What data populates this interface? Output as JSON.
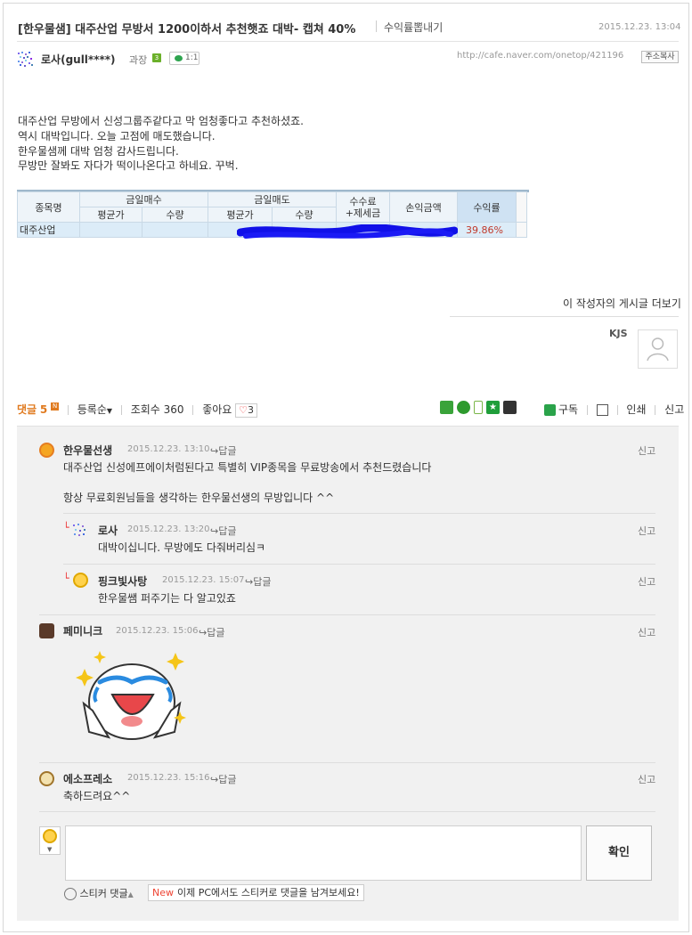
{
  "post": {
    "title": "[한우물샘] 대주산업 무방서 1200이하서 추천햇죠 대박- 캡쳐 40%",
    "export_label": "수익률뽑내기",
    "date": "2015.12.23. 13:04",
    "author": "로사(gull****)",
    "grade": "과장",
    "grade_level": "3",
    "chat_label": "1:1",
    "url": "http://cafe.naver.com/onetop/421196",
    "copy_label": "주소복사",
    "body_lines": [
      "대주산업 무방에서 신성그룹주같다고 막 엄청좋다고 추천하셨죠.",
      "역시 대박입니다. 오늘 고점에 매도했습니다.",
      "한우물샘께 대박 엄청 감사드립니다.",
      "무방만 잘봐도 자다가 떡이나온다고 하네요. 꾸벅."
    ],
    "more_posts_label": "이 작성자의 게시글 더보기",
    "signature_name": "KJS"
  },
  "trade_table": {
    "headers": {
      "stock": "종목명",
      "buy_group": "금일매수",
      "sell_group": "금일매도",
      "fee": "수수료",
      "fee2": "+제세금",
      "pnl": "손익금액",
      "rate": "수익률",
      "avg": "평균가",
      "qty": "수량"
    },
    "row": {
      "stock": "대주산업",
      "rate": "39.86%"
    }
  },
  "comment_bar": {
    "label": "댓글",
    "count": "5",
    "new_badge": "N",
    "sort_label": "등록순",
    "views": "조회수 360",
    "likes_label": "좋아요",
    "likes_count": "3",
    "share_icons": [
      "blog-icon",
      "me2day-icon",
      "phone-icon",
      "star-icon",
      "pholar-icon"
    ],
    "subscribe_label": "구독",
    "print_label": "인쇄",
    "report_label": "신고"
  },
  "comments": [
    {
      "name": "한우물선생",
      "date": "2015.12.23. 13:10",
      "reply": "답글",
      "report": "신고",
      "text1": "대주산업 신성에프에이처럼된다고 특별히 VIP종목을 무료방송에서 추천드렸습니다",
      "text2": "항상 무료회원님들을 생각하는 한우물선생의 무방입니다 ^^"
    },
    {
      "name": "로사",
      "date": "2015.12.23. 13:20",
      "reply": "답글",
      "report": "신고",
      "text1": "대박이십니다. 무방에도 다줘버리심ㅋ"
    },
    {
      "name": "핑크빛사탕",
      "date": "2015.12.23. 15:07",
      "reply": "답글",
      "report": "신고",
      "text1": "한우물쌤 퍼주기는 다 알고있죠"
    },
    {
      "name": "페미니크",
      "date": "2015.12.23. 15:06",
      "reply": "답글",
      "report": "신고"
    },
    {
      "name": "에소프레소",
      "date": "2015.12.23. 15:16",
      "reply": "답글",
      "report": "신고",
      "text1": "축하드려요^^"
    }
  ],
  "composer": {
    "submit_label": "확인",
    "sticker_label": "스티커 댓글",
    "new_label": "New",
    "notice": "이제 PC에서도 스티커로 댓글을 남겨보세요!"
  }
}
